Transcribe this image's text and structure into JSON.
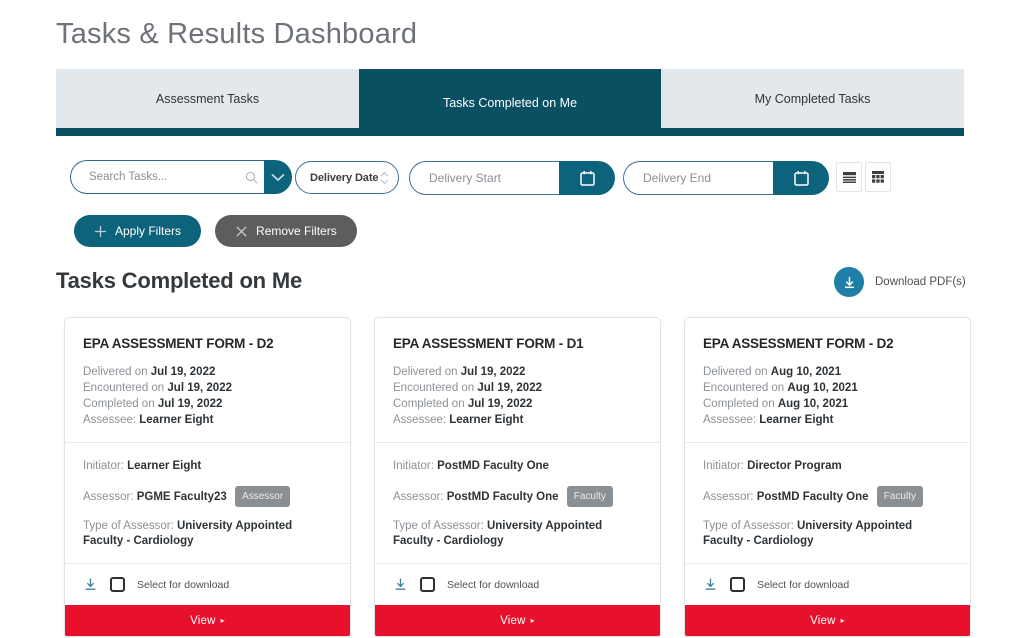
{
  "header": {
    "title": "Tasks & Results Dashboard"
  },
  "tabs": [
    {
      "label": "Assessment Tasks",
      "active": false
    },
    {
      "label": "Tasks Completed on Me",
      "active": true
    },
    {
      "label": "My Completed Tasks",
      "active": false
    }
  ],
  "toolbar": {
    "search": {
      "placeholder": "Search Tasks...",
      "value": "",
      "icon": "search-icon",
      "dropdown_icon": "chevron-down-icon"
    },
    "sort": {
      "selected": "Delivery Date",
      "icon": "up-down-arrows-icon"
    },
    "delivery_start": {
      "placeholder": "Delivery Start",
      "value": "",
      "icon": "calendar-icon"
    },
    "delivery_end": {
      "placeholder": "Delivery End",
      "value": "",
      "icon": "calendar-icon"
    },
    "view_list_icon": "list-view-icon",
    "view_grid_icon": "grid-view-icon"
  },
  "actions": {
    "apply_label": "Apply Filters",
    "apply_icon": "plus-icon",
    "remove_label": "Remove Filters",
    "remove_icon": "close-x-icon"
  },
  "section": {
    "title": "Tasks Completed on Me",
    "download_label": "Download PDF(s)",
    "download_icon": "download-circle-icon"
  },
  "colors": {
    "teal_dark": "#0a5063",
    "teal": "#0d627c",
    "red": "#e8112d",
    "gray_button": "#5d5d5d",
    "blue_circle": "#1f7fa8",
    "pill_gray": "#8a8f94"
  },
  "card_labels": {
    "delivered": "Delivered on",
    "encountered": "Encountered on",
    "completed": "Completed on",
    "assessee": "Assessee:",
    "initiator": "Initiator:",
    "assessor": "Assessor:",
    "type_of_assessor": "Type of Assessor:",
    "select_for_download": "Select for download",
    "view": "View",
    "view_caret": "▸",
    "download_icon": "download-icon"
  },
  "cards": [
    {
      "title": "EPA ASSESSMENT FORM - D2",
      "delivered_on": "Jul 19, 2022",
      "encountered_on": "Jul 19, 2022",
      "completed_on": "Jul 19, 2022",
      "assessee": "Learner Eight",
      "initiator": "Learner Eight",
      "assessor": "PGME Faculty23",
      "assessor_badge": "Assessor",
      "type_of_assessor": "University Appointed Faculty - Cardiology",
      "checked": false
    },
    {
      "title": "EPA ASSESSMENT FORM - D1",
      "delivered_on": "Jul 19, 2022",
      "encountered_on": "Jul 19, 2022",
      "completed_on": "Jul 19, 2022",
      "assessee": "Learner Eight",
      "initiator": "PostMD Faculty One",
      "assessor": "PostMD Faculty One",
      "assessor_badge": "Faculty",
      "type_of_assessor": "University Appointed Faculty - Cardiology",
      "checked": false
    },
    {
      "title": "EPA ASSESSMENT FORM - D2",
      "delivered_on": "Aug 10, 2021",
      "encountered_on": "Aug 10, 2021",
      "completed_on": "Aug 10, 2021",
      "assessee": "Learner Eight",
      "initiator": "Director Program",
      "assessor": "PostMD Faculty One",
      "assessor_badge": "Faculty",
      "type_of_assessor": "University Appointed Faculty - Cardiology",
      "checked": false
    }
  ]
}
